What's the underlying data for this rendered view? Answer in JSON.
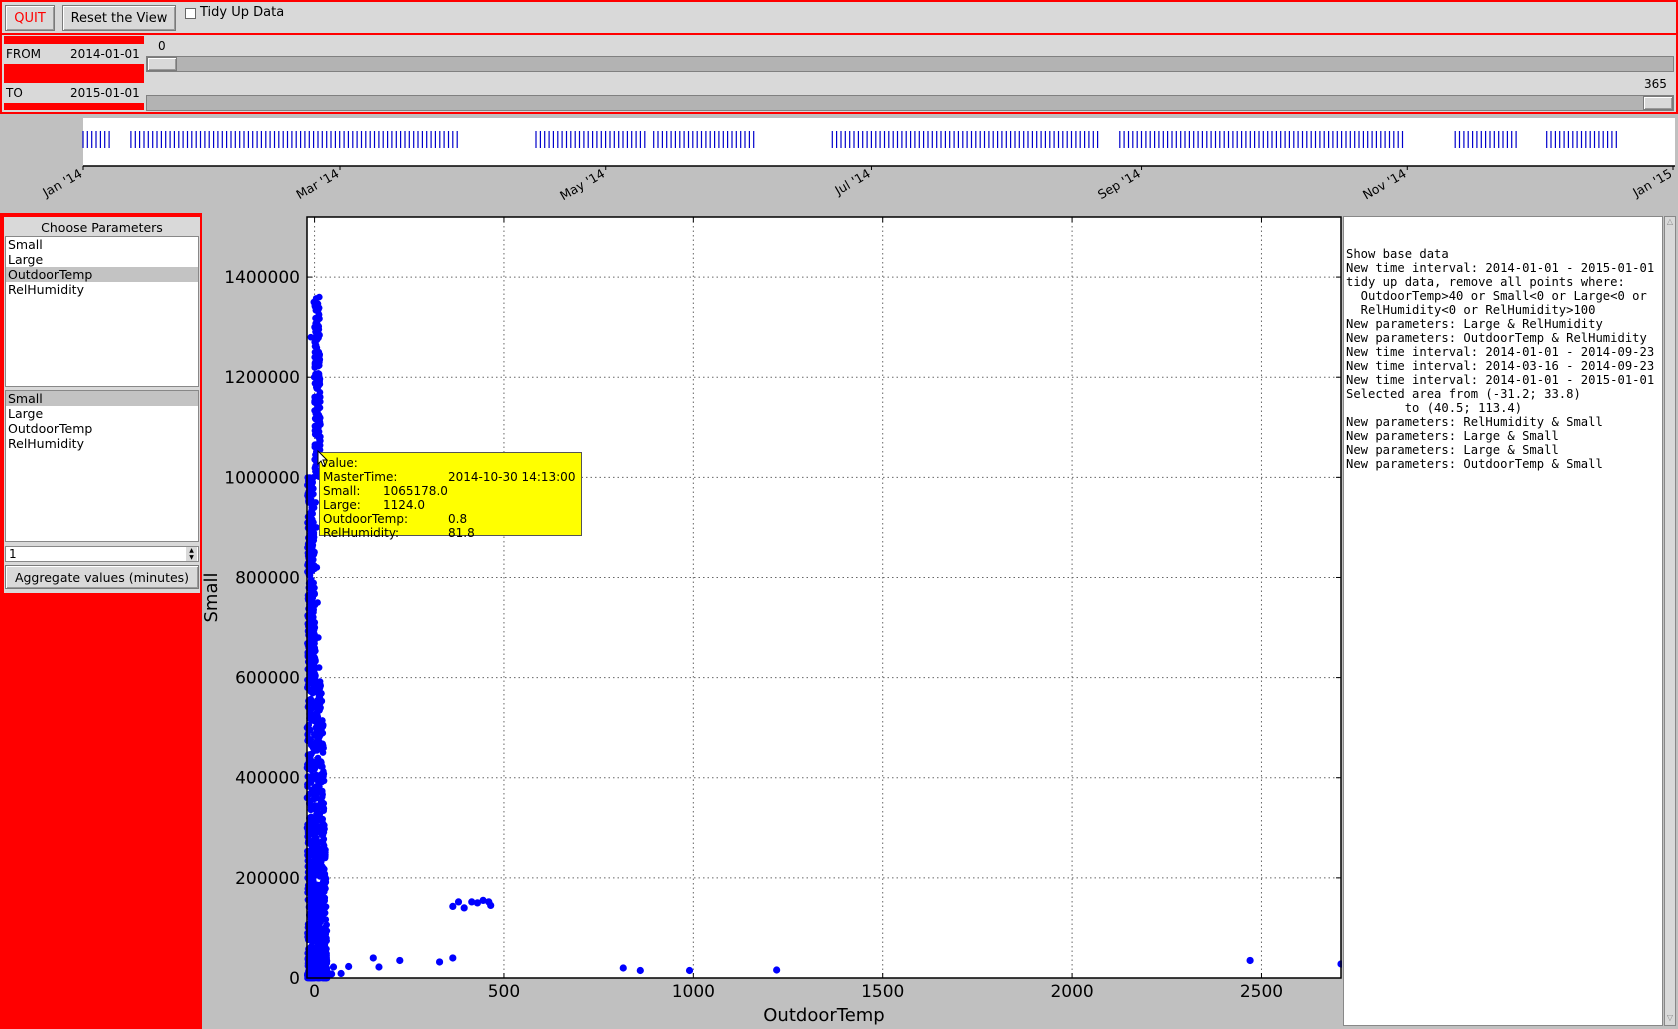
{
  "toolbar": {
    "quit_label": "QUIT",
    "reset_label": "Reset the View",
    "tidy_label": "Tidy Up Data",
    "tidy_checked": false
  },
  "time_range": {
    "from_label": "FROM",
    "from_value": "2014-01-01",
    "to_label": "TO",
    "to_value": "2015-01-01",
    "from_slider_value": "0",
    "to_slider_value": "365",
    "slider_max": 365
  },
  "timeline": {
    "month_labels": [
      "Jan '14",
      "Mar '14",
      "May '14",
      "Jul '14",
      "Sep '14",
      "Nov '14",
      "Jan '15"
    ],
    "data_ranges": [
      [
        "2014-01-01",
        "2014-01-07"
      ],
      [
        "2014-01-12",
        "2014-03-28"
      ],
      [
        "2014-04-15",
        "2014-05-10"
      ],
      [
        "2014-05-12",
        "2014-06-04"
      ],
      [
        "2014-06-22",
        "2014-08-22"
      ],
      [
        "2014-08-27",
        "2014-10-31"
      ],
      [
        "2014-11-12",
        "2014-11-26"
      ],
      [
        "2014-12-03",
        "2014-12-19"
      ]
    ],
    "tick_color": "#0000cc"
  },
  "params": {
    "title": "Choose Parameters",
    "x_list": [
      "Small",
      "Large",
      "OutdoorTemp",
      "RelHumidity"
    ],
    "x_selected": 2,
    "y_list": [
      "Small",
      "Large",
      "OutdoorTemp",
      "RelHumidity"
    ],
    "y_selected": 0,
    "aggregate_value": "1",
    "aggregate_label": "Aggregate values (minutes)"
  },
  "log": {
    "lines": [
      "Show base data",
      "New time interval: 2014-01-01 - 2015-01-01",
      "tidy up data, remove all points where:",
      "  OutdoorTemp>40 or Small<0 or Large<0 or",
      "  RelHumidity<0 or RelHumidity>100",
      "New parameters: Large & RelHumidity",
      "New parameters: OutdoorTemp & RelHumidity",
      "New time interval: 2014-01-01 - 2014-09-23",
      "New time interval: 2014-03-16 - 2014-09-23",
      "New time interval: 2014-01-01 - 2015-01-01",
      "Selected area from (-31.2; 33.8)",
      "        to (40.5; 113.4)",
      "New parameters: RelHumidity & Small",
      "New parameters: Large & Small",
      "New parameters: Large & Small",
      "New parameters: OutdoorTemp & Small"
    ]
  },
  "tooltip": {
    "title": "value:",
    "rows": [
      {
        "key": "MasterTime:",
        "val": "2014-10-30 14:13:00"
      },
      {
        "key": "Small:",
        "val": "1065178.0"
      },
      {
        "key": "Large:",
        "val": "1124.0"
      },
      {
        "key": "OutdoorTemp:",
        "val": "0.8"
      },
      {
        "key": "RelHumidity:",
        "val": "81.8"
      }
    ]
  },
  "colors": {
    "accent_red": "#ff0000",
    "point_blue": "#0000ff",
    "tooltip_yellow": "#ffff00"
  },
  "chart_data": {
    "type": "scatter",
    "xlabel": "OutdoorTemp",
    "ylabel": "Small",
    "xlim": [
      -20,
      2710
    ],
    "ylim": [
      0,
      1520000
    ],
    "xticks": [
      0,
      500,
      1000,
      1500,
      2000,
      2500
    ],
    "yticks": [
      0,
      200000,
      400000,
      600000,
      800000,
      1000000,
      1200000,
      1400000
    ],
    "grid": true,
    "point_color": "#0000ff",
    "cluster": {
      "description_points": [
        [
          -10,
          1280000
        ],
        [
          -2,
          1350000
        ],
        [
          0,
          1300000
        ],
        [
          1,
          1250000
        ],
        [
          -1,
          1200000
        ],
        [
          0,
          1150000
        ],
        [
          2,
          1100000
        ],
        [
          0.8,
          1065178
        ],
        [
          -3,
          1000000
        ],
        [
          -12,
          880000
        ],
        [
          -14,
          820000
        ],
        [
          -16,
          720000
        ],
        [
          -18,
          650000
        ],
        [
          -19,
          580000
        ],
        [
          3,
          950000
        ],
        [
          5,
          900000
        ],
        [
          6,
          820000
        ],
        [
          8,
          750000
        ],
        [
          10,
          680000
        ],
        [
          12,
          620000
        ],
        [
          14,
          560000
        ],
        [
          16,
          500000
        ],
        [
          18,
          430000
        ],
        [
          20,
          370000
        ],
        [
          22,
          300000
        ],
        [
          24,
          240000
        ],
        [
          26,
          180000
        ],
        [
          28,
          130000
        ],
        [
          30,
          80000
        ],
        [
          32,
          40000
        ],
        [
          -20,
          500000
        ],
        [
          -20,
          420000
        ],
        [
          -20,
          360000
        ],
        [
          -20,
          300000
        ]
      ]
    },
    "points": [
      [
        50,
        22000
      ],
      [
        45,
        8000
      ],
      [
        70,
        9000
      ],
      [
        90,
        23000
      ],
      [
        155,
        40000
      ],
      [
        170,
        22000
      ],
      [
        225,
        35000
      ],
      [
        330,
        32000
      ],
      [
        365,
        40000
      ],
      [
        365,
        143000
      ],
      [
        380,
        152000
      ],
      [
        395,
        140000
      ],
      [
        415,
        152000
      ],
      [
        430,
        150000
      ],
      [
        445,
        155000
      ],
      [
        460,
        152000
      ],
      [
        465,
        145000
      ],
      [
        815,
        20000
      ],
      [
        860,
        15000
      ],
      [
        990,
        15000
      ],
      [
        1220,
        16000
      ],
      [
        2470,
        35000
      ],
      [
        2710,
        28000
      ]
    ]
  }
}
